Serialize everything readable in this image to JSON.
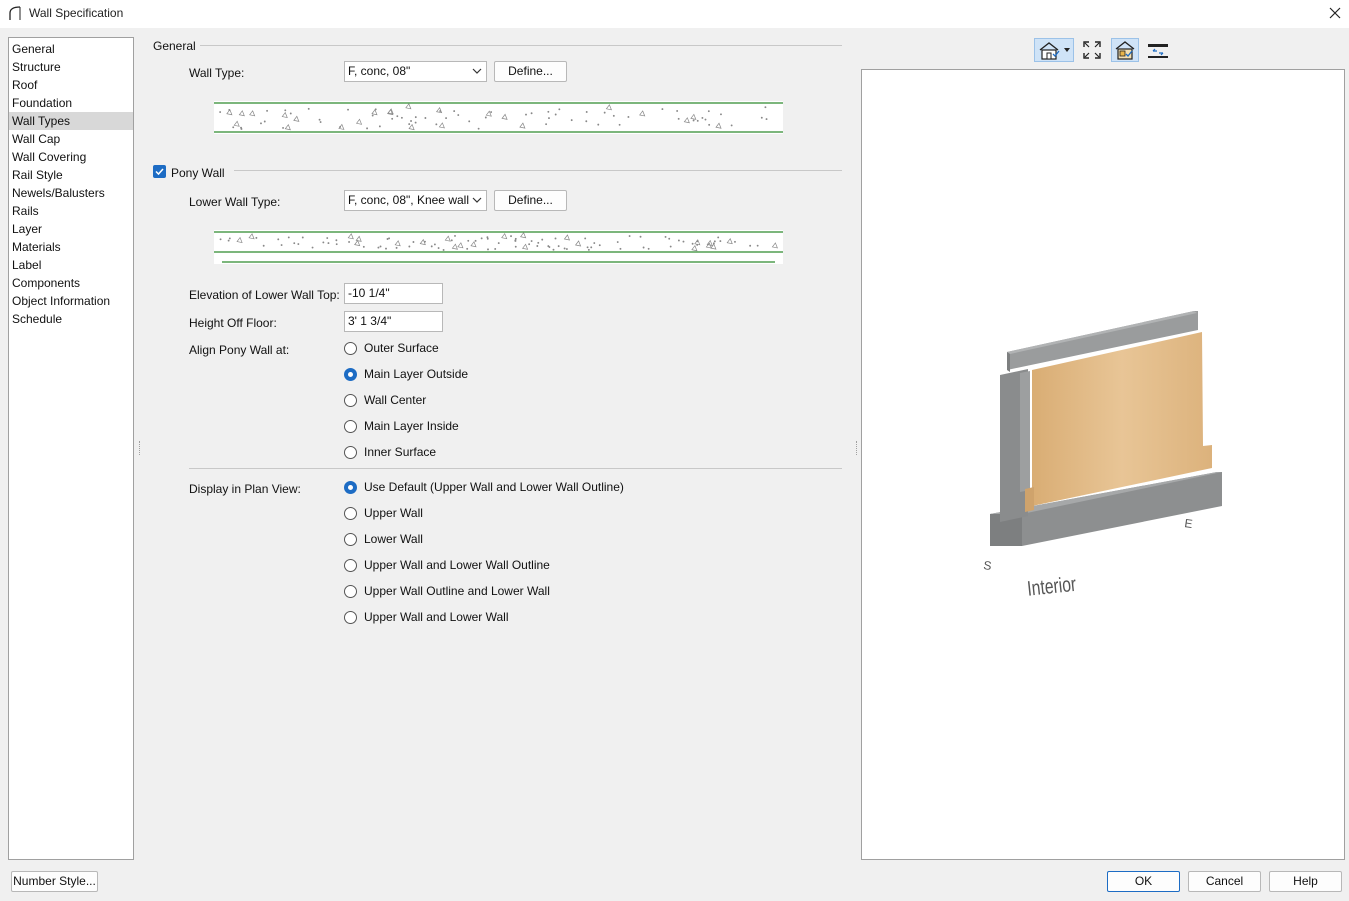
{
  "window": {
    "title": "Wall Specification"
  },
  "categories": [
    {
      "label": "General"
    },
    {
      "label": "Structure"
    },
    {
      "label": "Roof"
    },
    {
      "label": "Foundation"
    },
    {
      "label": "Wall Types",
      "selected": true
    },
    {
      "label": "Wall Cap"
    },
    {
      "label": "Wall Covering"
    },
    {
      "label": "Rail Style"
    },
    {
      "label": "Newels/Balusters"
    },
    {
      "label": "Rails"
    },
    {
      "label": "Layer"
    },
    {
      "label": "Materials"
    },
    {
      "label": "Label"
    },
    {
      "label": "Components"
    },
    {
      "label": "Object Information"
    },
    {
      "label": "Schedule"
    }
  ],
  "general": {
    "group_label": "General",
    "wall_type_label": "Wall Type:",
    "wall_type_value": "F, conc, 08\"",
    "define_label": "Define..."
  },
  "pony_wall": {
    "checkbox_label": "Pony Wall",
    "checked": true,
    "lower_wall_type_label": "Lower Wall Type:",
    "lower_wall_type_value": "F, conc, 08\", Knee wall",
    "define_label": "Define...",
    "elevation_label": "Elevation of Lower Wall Top:",
    "elevation_value": "-10 1/4\"",
    "height_label": "Height Off Floor:",
    "height_value": "3' 1 3/4\"",
    "align_label": "Align Pony Wall at:",
    "align_options": [
      {
        "label": "Outer Surface",
        "checked": false
      },
      {
        "label": "Main Layer Outside",
        "checked": true
      },
      {
        "label": "Wall Center",
        "checked": false
      },
      {
        "label": "Main Layer Inside",
        "checked": false
      },
      {
        "label": "Inner Surface",
        "checked": false
      }
    ],
    "display_label": "Display in Plan View:",
    "display_options": [
      {
        "label": "Use Default (Upper Wall and Lower Wall Outline)",
        "checked": true
      },
      {
        "label": "Upper Wall",
        "checked": false
      },
      {
        "label": "Lower Wall",
        "checked": false
      },
      {
        "label": "Upper Wall and Lower Wall Outline",
        "checked": false
      },
      {
        "label": "Upper Wall Outline and Lower Wall",
        "checked": false
      },
      {
        "label": "Upper Wall and Lower Wall",
        "checked": false
      }
    ]
  },
  "preview": {
    "toolbar": [
      "house-view-icon",
      "fill-window-icon",
      "wall-preview-icon",
      "swap-sides-icon"
    ],
    "label_interior": "Interior",
    "label_s": "S",
    "label_e": "E"
  },
  "footer": {
    "number_style_label": "Number Style...",
    "ok_label": "OK",
    "cancel_label": "Cancel",
    "help_label": "Help"
  },
  "colors": {
    "accent": "#1d6cc4",
    "concrete": "#8f9293",
    "wood": "#e4bd8a",
    "hatch_line": "#2e8b2e"
  }
}
